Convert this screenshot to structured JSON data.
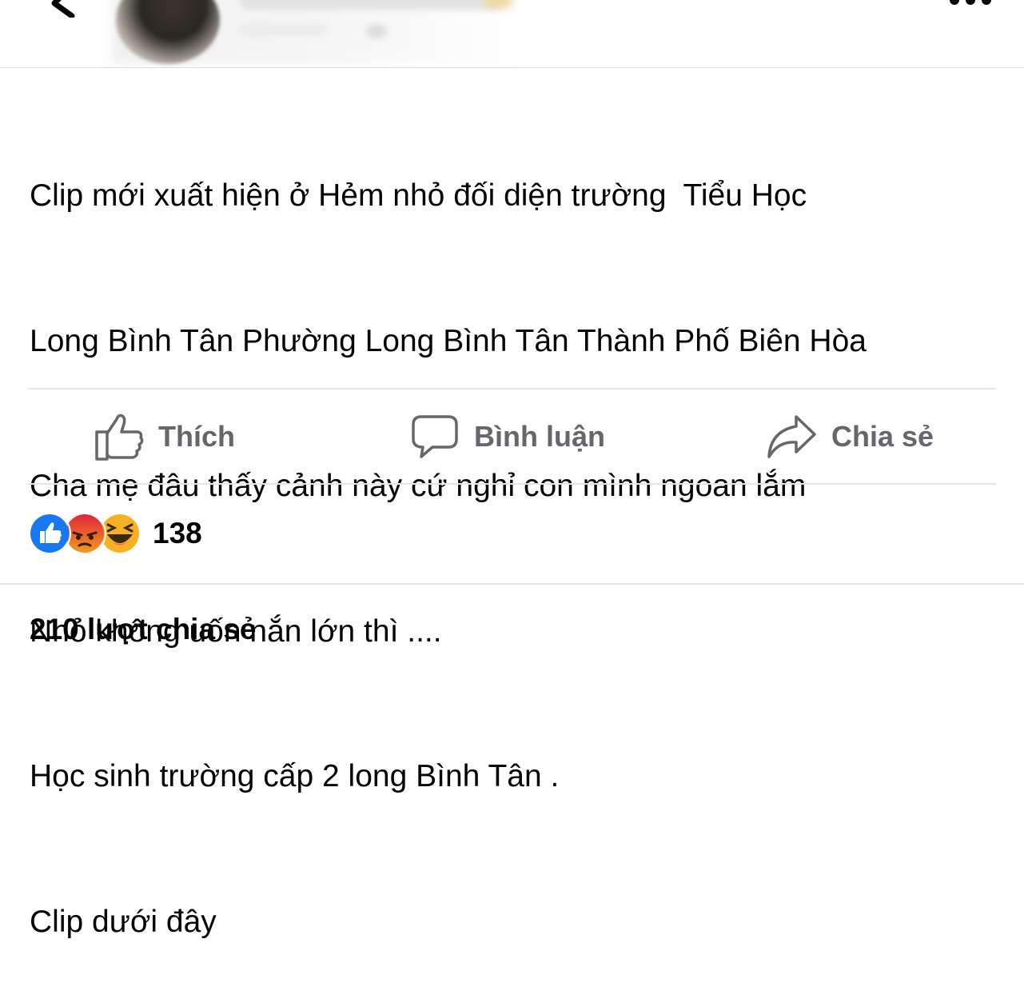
{
  "post": {
    "lines": [
      "Clip mới xuất hiện ở Hẻm nhỏ đối diện trường  Tiểu Học",
      "Long Bình Tân Phường Long Bình Tân Thành Phố Biên Hòa",
      "Cha mẹ đâu thấy cảnh này cứ nghỉ con mình ngoan lắm",
      "Nhỏ không uốn nắn lớn thì ....",
      "Học sinh trường cấp 2 long Bình Tân .",
      "Clip dưới đây"
    ]
  },
  "actions": {
    "like_label": "Thích",
    "comment_label": "Bình luận",
    "share_label": "Chia sẻ"
  },
  "reactions": {
    "icons": [
      "like-reaction-icon",
      "angry-reaction-icon",
      "haha-reaction-icon"
    ],
    "count": "138"
  },
  "shares": {
    "label": "210 lượt chia sẻ"
  },
  "colors": {
    "action_gray": "#65676b",
    "like_blue": "#1877f2",
    "angry_orange": "#e9710f",
    "haha_yellow": "#f7b125"
  }
}
